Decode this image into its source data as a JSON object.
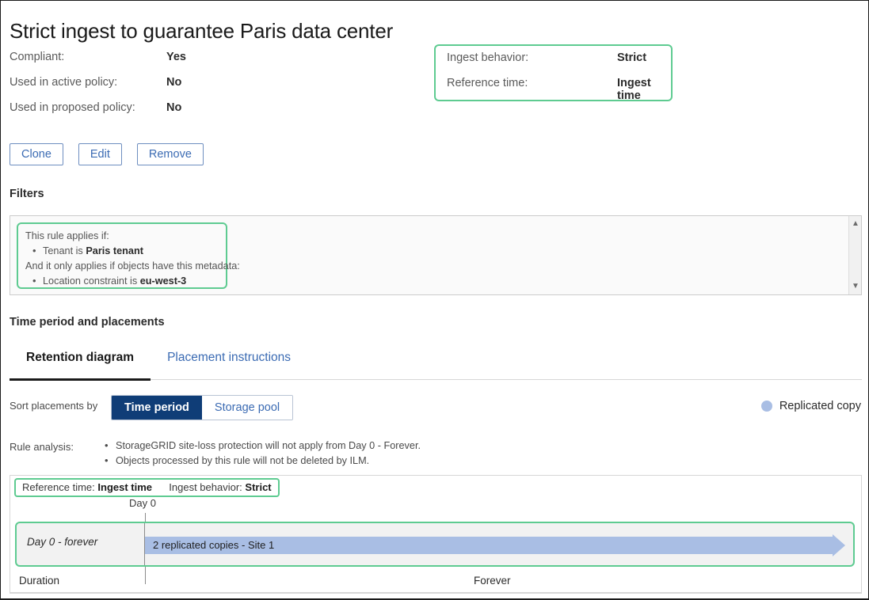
{
  "page_title": "Strict ingest to guarantee Paris data center",
  "summary": {
    "rows": [
      {
        "label": "Compliant:",
        "value": "Yes"
      },
      {
        "label": "Used in active policy:",
        "value": "No"
      },
      {
        "label": "Used in proposed policy:",
        "value": "No"
      }
    ]
  },
  "ingest_box": {
    "rows": [
      {
        "label": "Ingest behavior:",
        "value": "Strict"
      },
      {
        "label": "Reference time:",
        "value": "Ingest time"
      }
    ],
    "border_color": "#5ecb91"
  },
  "actions": {
    "clone_label": "Clone",
    "edit_label": "Edit",
    "remove_label": "Remove"
  },
  "filters": {
    "heading": "Filters",
    "intro": "This rule applies if:",
    "criterion_1_prefix": "Tenant is ",
    "criterion_1_value": "Paris tenant",
    "metadata_intro": "And it only applies if objects have this metadata:",
    "criterion_2_prefix": "Location constraint is ",
    "criterion_2_value": "eu-west-3",
    "scroll_up_icon": "chevron-up-icon",
    "scroll_down_icon": "chevron-down-icon"
  },
  "time_period": {
    "heading": "Time period and placements",
    "tabs": [
      {
        "label": "Retention diagram",
        "active": true
      },
      {
        "label": "Placement instructions",
        "active": false
      }
    ],
    "sort_label": "Sort placements by",
    "sort_options": [
      {
        "label": "Time period",
        "active": true
      },
      {
        "label": "Storage pool",
        "active": false
      }
    ],
    "legend": {
      "dot_color": "#a9bee4",
      "label": "Replicated copy"
    },
    "analysis_label": "Rule analysis:",
    "analysis_items": [
      "StorageGRID site-loss protection will not apply from Day 0 - Forever.",
      "Objects processed by this rule will not be deleted by ILM."
    ]
  },
  "chart_data": {
    "type": "bar",
    "title": "Retention diagram",
    "xlabel": "Duration",
    "header": {
      "reference_time_label": "Reference time:",
      "reference_time_value": "Ingest time",
      "ingest_behavior_label": "Ingest behavior:",
      "ingest_behavior_value": "Strict"
    },
    "axis_ticks": [
      {
        "label": "Day 0",
        "position_pct": 15.4
      },
      {
        "label": "Forever",
        "position_pct": 55.0
      }
    ],
    "duration_axis_label": "Duration",
    "categories": [
      "Day 0 - forever"
    ],
    "series": [
      {
        "name": "Replicated copy",
        "color": "#a9bee4",
        "bars": [
          {
            "period": "Day 0 - forever",
            "label": "2 replicated copies - Site 1",
            "copies": 2,
            "site": "Site 1",
            "start": "Day 0",
            "end": "Forever",
            "open_ended": true
          }
        ]
      }
    ],
    "legend_position": "top-right",
    "grid": false
  }
}
